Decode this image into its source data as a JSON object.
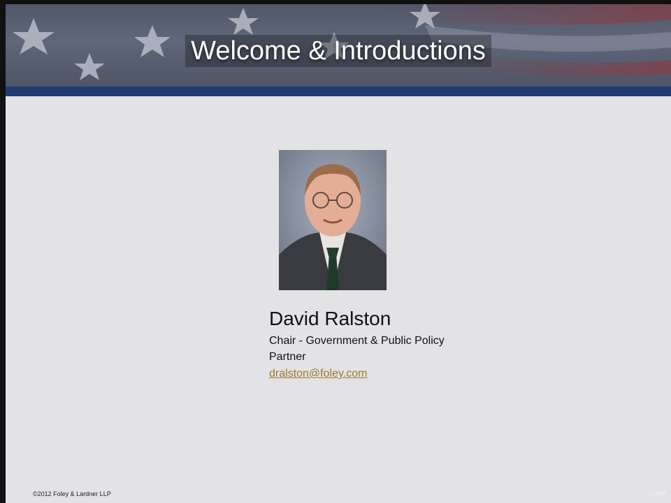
{
  "slide": {
    "title": "Welcome & Introductions",
    "person": {
      "name": "David Ralston",
      "role_line1": "Chair -  Government & Public Policy",
      "role_line2": "Partner",
      "email": "dralston@foley.com"
    },
    "footer": {
      "copyright": "©2012 Foley & Lardner LLP",
      "code": "12.9087"
    }
  },
  "colors": {
    "background": "#e3e3e5",
    "banner_accent": "#1f3c73",
    "link": "#9b7a2e"
  },
  "icons": {
    "banner_image": "american-flag",
    "photo": "portrait-photo"
  }
}
